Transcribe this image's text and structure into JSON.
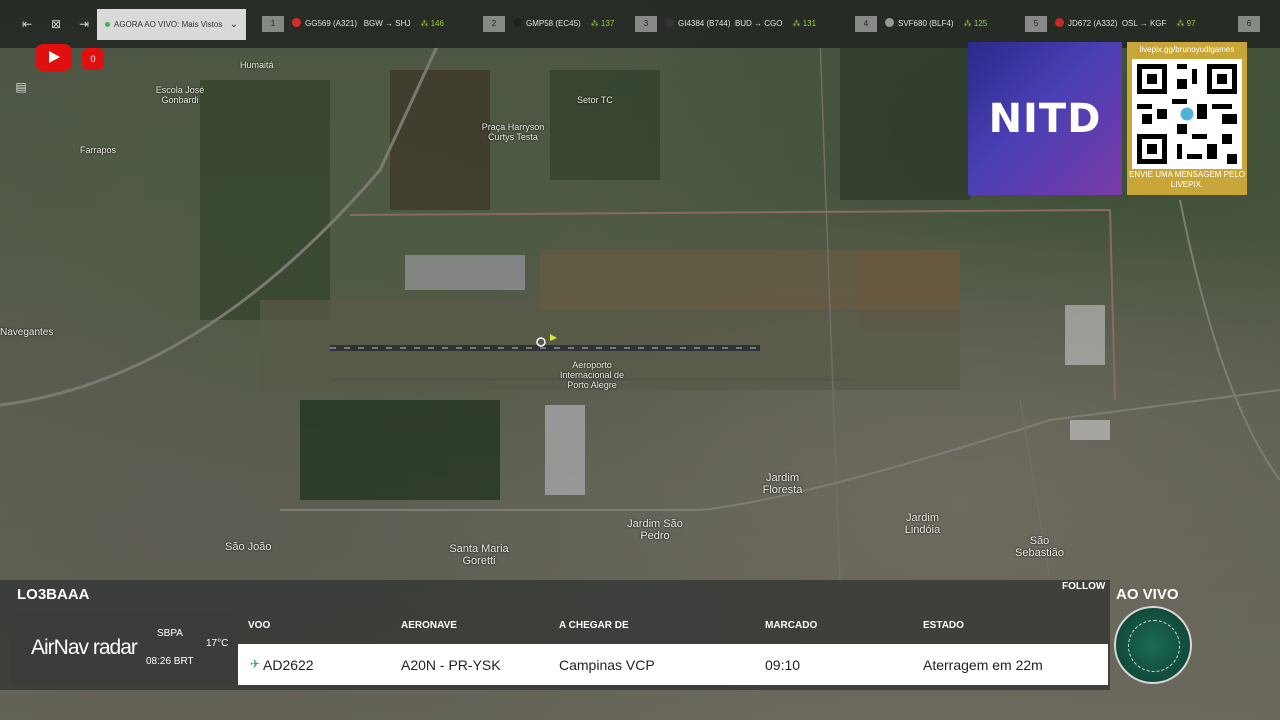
{
  "topbar": {
    "live_label": "AGORA AO VIVO: Mais Vistos",
    "flights": [
      {
        "rank": "1",
        "callsign": "GG569 (A321)",
        "route": "BGW → SHJ",
        "count": "146",
        "logo_color": "#d92b2b"
      },
      {
        "rank": "2",
        "callsign": "GMP58 (EC45)",
        "route": "",
        "count": "137",
        "logo_color": "#1f1f1f"
      },
      {
        "rank": "3",
        "callsign": "GI4384 (B744)",
        "route": "BUD → CGO",
        "count": "131",
        "logo_color": "#333333"
      },
      {
        "rank": "4",
        "callsign": "SVF680 (BLF4)",
        "route": "",
        "count": "125",
        "logo_color": "#999999"
      },
      {
        "rank": "5",
        "callsign": "JD672 (A332)",
        "route": "OSL → KGF",
        "count": "97",
        "logo_color": "#c62828"
      },
      {
        "rank": "6",
        "callsign": "",
        "route": "",
        "count": "",
        "logo_color": ""
      }
    ]
  },
  "youtube": {
    "count": "0"
  },
  "map_labels": {
    "humaita": "Humaitá",
    "farrapos": "Farrapos",
    "setor_tc": "Setor TC",
    "praca": "Praça Harryson Curtys Testa",
    "aeroporto": "Aeroporto Internacional de Porto Alegre",
    "jardim_floresta": "Jardim Floresta",
    "jardim_sao_pedro": "Jardim São Pedro",
    "jardim_lindoia": "Jardim Lindóia",
    "sao_sebastiao": "São Sebastião",
    "santa_maria_goretti": "Santa Maria Goretti",
    "sao_joao": "São João",
    "navegantes": "Navegantes",
    "escola": "Escola José Gonbardi"
  },
  "overlays": {
    "nitd_text": "NITD",
    "livepix_url": "livepix.gg/brunoyudigames",
    "livepix_msg": "ENVIE UMA MENSAGEM PELO LIVEPIX.",
    "ao_vivo": "AO VIVO"
  },
  "panel": {
    "registration": "LO3BAAA",
    "follow": "FOLLOW",
    "brand": "AirNav radar",
    "airport_code": "SBPA",
    "local_time": "08:26 BRT",
    "temperature": "17°C",
    "headers": {
      "flight": "VOO",
      "aircraft": "AERONAVE",
      "from": "A CHEGAR DE",
      "scheduled": "MARCADO",
      "status": "ESTADO"
    },
    "row": {
      "flight": "AD2622",
      "aircraft": "A20N - PR-YSK",
      "from": "Campinas VCP",
      "scheduled": "09:10",
      "status": "Aterragem em 22m"
    }
  },
  "colors": {
    "accent_green": "#9ecf3a",
    "youtube_red": "#e01010",
    "livepix_gold": "#c8a63a"
  }
}
